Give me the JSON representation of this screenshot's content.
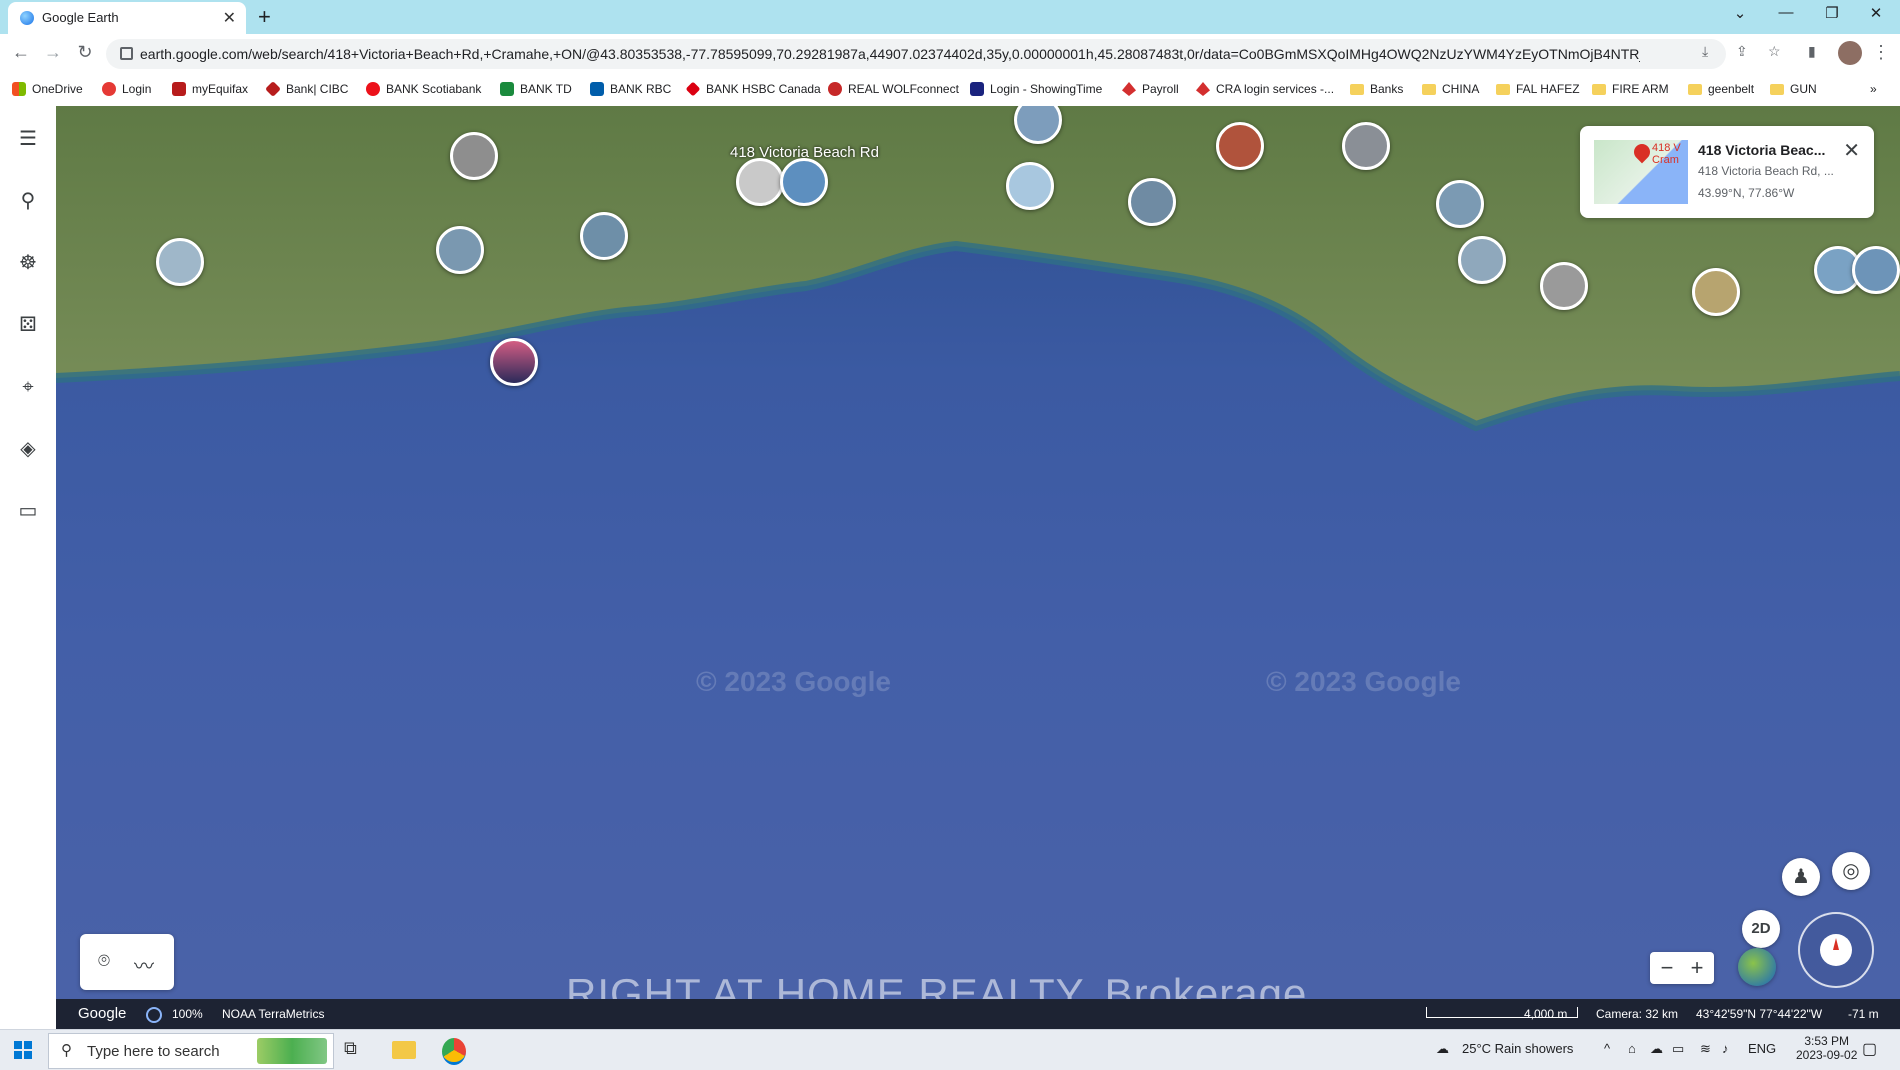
{
  "browser": {
    "tab_title": "Google Earth",
    "tab_close": "✕",
    "new_tab": "+",
    "url": "earth.google.com/web/search/418+Victoria+Beach+Rd,+Cramahe,+ON/@43.80353538,-77.78595099,70.29281987a,44907.02374402d,35y,0.00000001h,45.28087483t,0r/data=Co0BGmMSXQoIMHg4OWQ2NzUzYWM4YzEyOTNmOjB4NTRjMDQwODY1O...",
    "controls": {
      "dropdown": "⌄",
      "minimize": "—",
      "restore": "❐",
      "close": "✕"
    },
    "nav": {
      "back": "←",
      "forward": "→",
      "reload": "↻",
      "menu": "⋮"
    }
  },
  "bookmarks": [
    {
      "label": "OneDrive",
      "color": "#f25022"
    },
    {
      "label": "Login",
      "color": "#e53935"
    },
    {
      "label": "myEquifax",
      "color": "#b71c1c"
    },
    {
      "label": "Bank| CIBC",
      "color": "#b71c1c"
    },
    {
      "label": "BANK Scotiabank",
      "color": "#ec111a"
    },
    {
      "label": "BANK TD",
      "color": "#1a8a3d"
    },
    {
      "label": "BANK RBC",
      "color": "#005daa"
    },
    {
      "label": "BANK HSBC Canada",
      "color": "#db0011"
    },
    {
      "label": "REAL WOLFconnect",
      "color": "#c62828"
    },
    {
      "label": "Login - ShowingTime",
      "color": "#1a237e"
    },
    {
      "label": "Payroll",
      "color": "#d32f2f"
    },
    {
      "label": "CRA login services -...",
      "color": "#d32f2f"
    },
    {
      "label": "Banks",
      "color": "folder"
    },
    {
      "label": "CHINA",
      "color": "folder"
    },
    {
      "label": "FAL HAFEZ",
      "color": "folder"
    },
    {
      "label": "FIRE ARM",
      "color": "folder"
    },
    {
      "label": "geenbelt",
      "color": "folder"
    },
    {
      "label": "GUN",
      "color": "folder"
    }
  ],
  "bookmarks_more": "»",
  "earth": {
    "map_label": "418 Victoria Beach Rd",
    "watermarks": [
      "© 2023 Google",
      "© 2023 Google"
    ],
    "card": {
      "thumb_text_1": "418 V",
      "thumb_text_2": "Cram",
      "name": "418 Victoria Beac...",
      "address": "418 Victoria Beach Rd, ...",
      "coords": "43.99°N, 77.86°W",
      "close": "✕"
    },
    "controls": {
      "two_d": "2D",
      "zoom_out": "−",
      "zoom_in": "+"
    },
    "brokerage": "RIGHT AT HOME REALTY, Brokerage",
    "status": {
      "logo": "Google",
      "load_pct": "100%",
      "credits": "NOAA  TerraMetrics",
      "scale": "4,000 m",
      "camera": "Camera: 32 km",
      "position": "43°42'59\"N 77°44'22\"W",
      "elevation": "-71 m"
    }
  },
  "taskbar": {
    "search_placeholder": "Type here to search",
    "weather": "25°C  Rain showers",
    "lang": "ENG",
    "time": "3:53 PM",
    "date": "2023-09-02"
  }
}
